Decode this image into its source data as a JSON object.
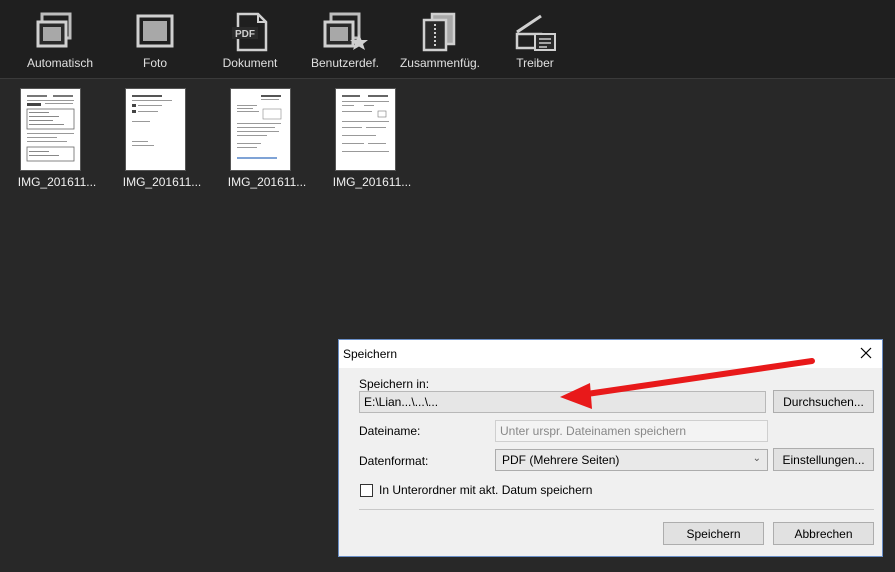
{
  "toolbar": {
    "items": [
      {
        "label": "Automatisch",
        "icon": "auto-scan-icon"
      },
      {
        "label": "Foto",
        "icon": "photo-icon"
      },
      {
        "label": "Dokument",
        "icon": "pdf-document-icon"
      },
      {
        "label": "Benutzerdef.",
        "icon": "custom-star-icon"
      },
      {
        "label": "Zusammenfüg.",
        "icon": "merge-icon"
      },
      {
        "label": "Treiber",
        "icon": "scanner-driver-icon"
      }
    ]
  },
  "thumbnails": [
    {
      "name": "IMG_201611..."
    },
    {
      "name": "IMG_201611..."
    },
    {
      "name": "IMG_201611..."
    },
    {
      "name": "IMG_201611..."
    }
  ],
  "dialog": {
    "title": "Speichern",
    "save_in_label": "Speichern in:",
    "save_in_value": "E:\\Lian...\\...\\...",
    "browse_label": "Durchsuchen...",
    "filename_label": "Dateiname:",
    "filename_placeholder": "Unter urspr. Dateinamen speichern",
    "format_label": "Datenformat:",
    "format_value": "PDF (Mehrere Seiten)",
    "settings_label": "Einstellungen...",
    "subfolder_label": "In Unterordner mit akt. Datum speichern",
    "subfolder_checked": false,
    "save_label": "Speichern",
    "cancel_label": "Abbrechen"
  },
  "colors": {
    "background": "#282828",
    "toolbar": "#1f1f1f",
    "annotation_arrow": "#e8191a",
    "dialog_border": "#6a8fc7"
  }
}
